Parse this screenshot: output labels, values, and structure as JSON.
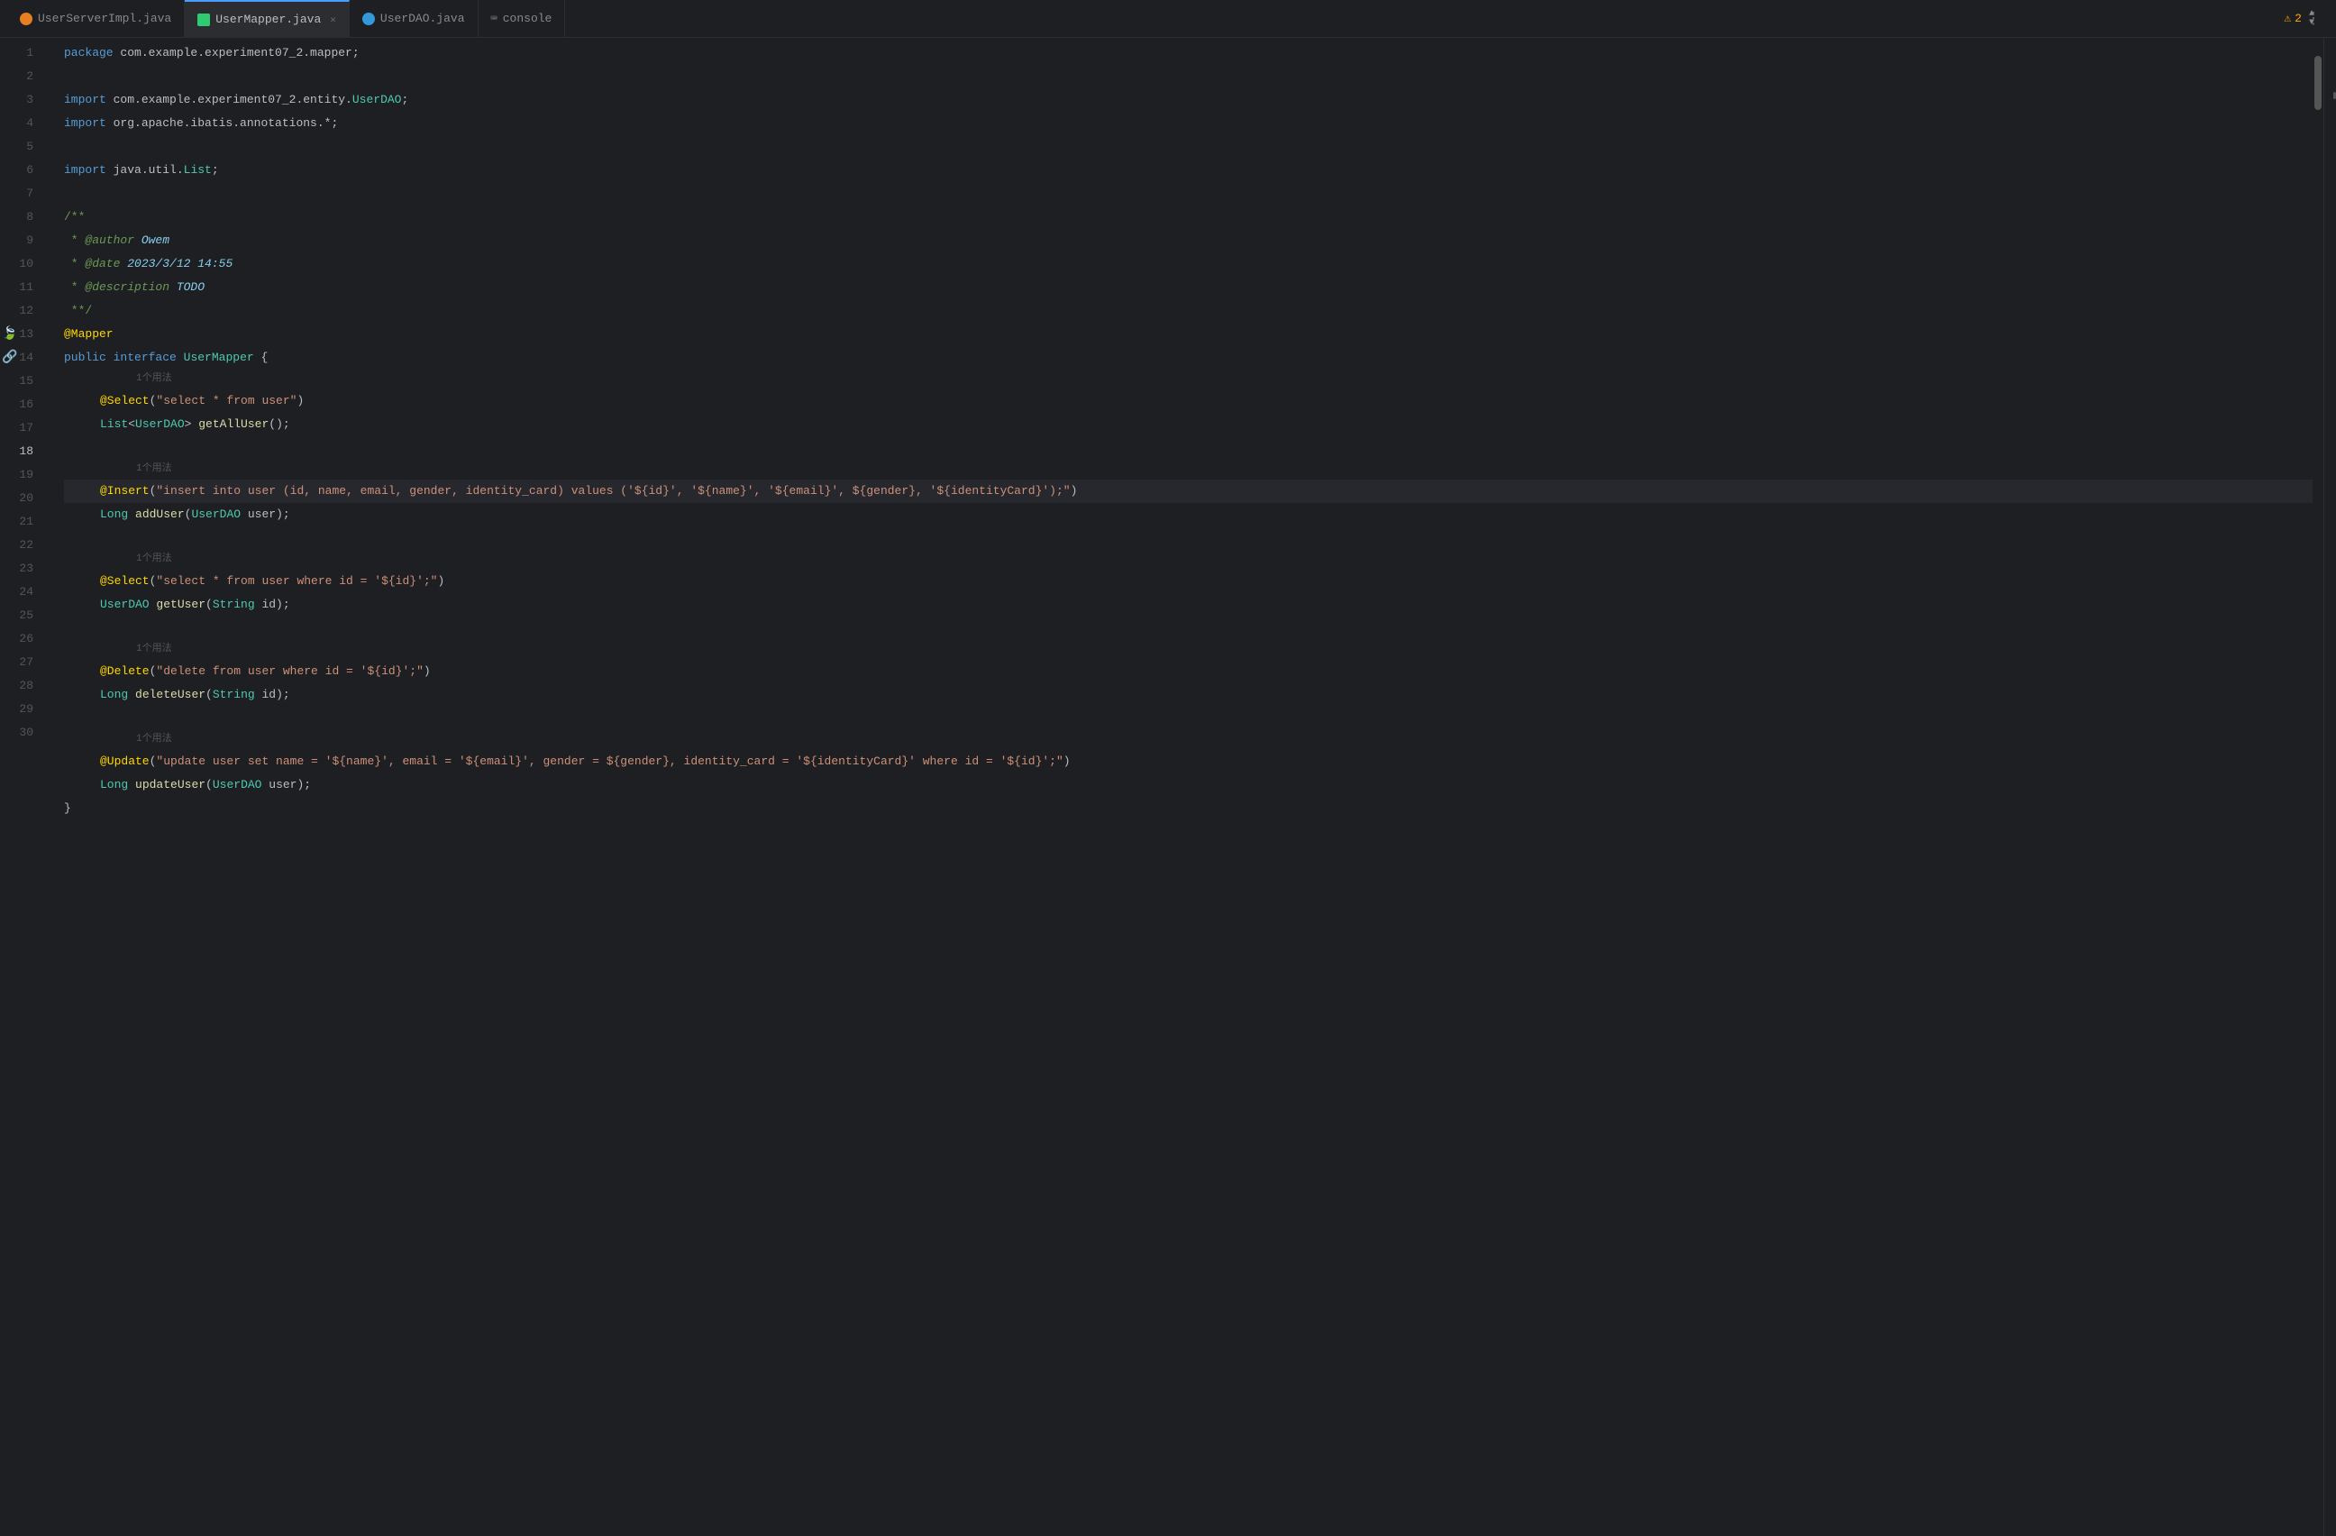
{
  "tabs": [
    {
      "id": "tab-1",
      "label": "UserServerImpl.java",
      "icon": "orange",
      "active": false,
      "closeable": false
    },
    {
      "id": "tab-2",
      "label": "UserMapper.java",
      "icon": "teal",
      "active": true,
      "closeable": true
    },
    {
      "id": "tab-3",
      "label": "UserDAO.java",
      "icon": "blue",
      "active": false,
      "closeable": false
    },
    {
      "id": "tab-4",
      "label": "console",
      "icon": "none",
      "active": false,
      "closeable": false
    }
  ],
  "warning_count": "2",
  "lines": [
    {
      "num": "1",
      "content": "package_line",
      "active": false
    },
    {
      "num": "2",
      "content": "empty",
      "active": false
    },
    {
      "num": "3",
      "content": "import1",
      "active": false
    },
    {
      "num": "4",
      "content": "import2",
      "active": false
    },
    {
      "num": "5",
      "content": "empty",
      "active": false
    },
    {
      "num": "6",
      "content": "import3",
      "active": false
    },
    {
      "num": "7",
      "content": "empty",
      "active": false
    },
    {
      "num": "8",
      "content": "javadoc_start",
      "active": false
    },
    {
      "num": "9",
      "content": "javadoc_author",
      "active": false
    },
    {
      "num": "10",
      "content": "javadoc_date",
      "active": false
    },
    {
      "num": "11",
      "content": "javadoc_desc",
      "active": false
    },
    {
      "num": "12",
      "content": "javadoc_end",
      "active": false
    },
    {
      "num": "13",
      "content": "mapper_ann",
      "active": false,
      "gutter": "leaf"
    },
    {
      "num": "14",
      "content": "interface_decl",
      "active": false,
      "gutter": "leaf2"
    },
    {
      "num": "15",
      "content": "select_ann1",
      "active": false
    },
    {
      "num": "16",
      "content": "getAllUser",
      "active": false
    },
    {
      "num": "17",
      "content": "empty",
      "active": false
    },
    {
      "num": "18",
      "content": "insert_ann",
      "active": true
    },
    {
      "num": "19",
      "content": "addUser",
      "active": false
    },
    {
      "num": "20",
      "content": "empty",
      "active": false
    },
    {
      "num": "21",
      "content": "select_ann2",
      "active": false
    },
    {
      "num": "22",
      "content": "getUser",
      "active": false
    },
    {
      "num": "23",
      "content": "empty",
      "active": false
    },
    {
      "num": "24",
      "content": "delete_ann",
      "active": false
    },
    {
      "num": "25",
      "content": "deleteUser",
      "active": false
    },
    {
      "num": "26",
      "content": "empty",
      "active": false
    },
    {
      "num": "27",
      "content": "update_ann",
      "active": false
    },
    {
      "num": "28",
      "content": "updateUser",
      "active": false
    },
    {
      "num": "29",
      "content": "close_brace",
      "active": false
    },
    {
      "num": "30",
      "content": "empty",
      "active": false
    }
  ],
  "hint_1method": "1个用法",
  "colors": {
    "bg": "#1e1f22",
    "active_line": "#26282e",
    "tab_active_bg": "#2b2d30"
  }
}
